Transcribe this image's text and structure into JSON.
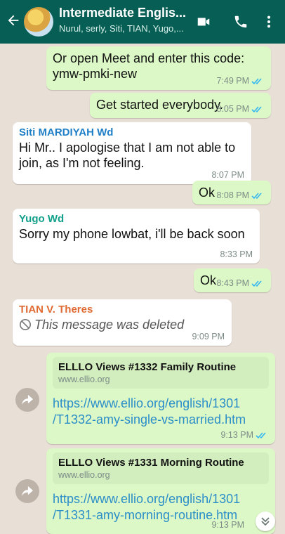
{
  "header": {
    "title": "Intermediate Englis...",
    "subtitle": "Nurul, serly, Siti, TIAN, Yugo,...",
    "icons": [
      "back-arrow-icon",
      "video-call-icon",
      "voice-call-icon",
      "more-options-icon"
    ]
  },
  "colors": {
    "header_bg": "#075e54",
    "outgoing_bubble": "#dcf8c6",
    "incoming_bubble": "#ffffff",
    "link": "#2b8ec9",
    "read_ticks": "#34b7f1"
  },
  "messages": [
    {
      "type": "out",
      "text": "Or open Meet and enter this code: ymw-pmki-new",
      "time": "7:49 PM"
    },
    {
      "type": "out",
      "text": "Get started everybody.",
      "time": "8:05 PM"
    },
    {
      "type": "in",
      "sender": "Siti MARDIYAH Wd",
      "sender_color": "#1f7fc6",
      "text": "Hi Mr.. I apologise that I am not able to join, as I'm not feeling.",
      "time": "8:07 PM"
    },
    {
      "type": "out",
      "text": "Ok",
      "time": "8:08 PM"
    },
    {
      "type": "in",
      "sender": "Yugo Wd",
      "sender_color": "#12a08a",
      "text": "Sorry my phone lowbat, i'll be back soon",
      "time": "8:33 PM"
    },
    {
      "type": "out",
      "text": "Ok",
      "time": "8:43 PM"
    },
    {
      "type": "in",
      "sender": "TIAN V. Theres",
      "sender_color": "#e06a33",
      "text": "This message was deleted",
      "time": "9:09 PM"
    },
    {
      "type": "link",
      "preview_title": "ELLLO Views #1332 Family Routine",
      "preview_site": "www.ellio.org",
      "url": "https://www.ellio.org/english/1301/T1332-amy-single-vs-married.htm",
      "url_line1": "https://www.ellio.org/english/1301",
      "url_line2": "/T1332-amy-single-vs-married.htm",
      "time": "9:13 PM"
    },
    {
      "type": "link",
      "preview_title": "ELLLO Views #1331 Morning Routine",
      "preview_site": "www.ellio.org",
      "url": "https://www.ellio.org/english/1301/T1331-amy-morning-routine.htm",
      "url_line1": "https://www.ellio.org/english/1301",
      "url_line2": "/T1331-amy-morning-routine.htm",
      "time": "9:13 PM"
    }
  ]
}
